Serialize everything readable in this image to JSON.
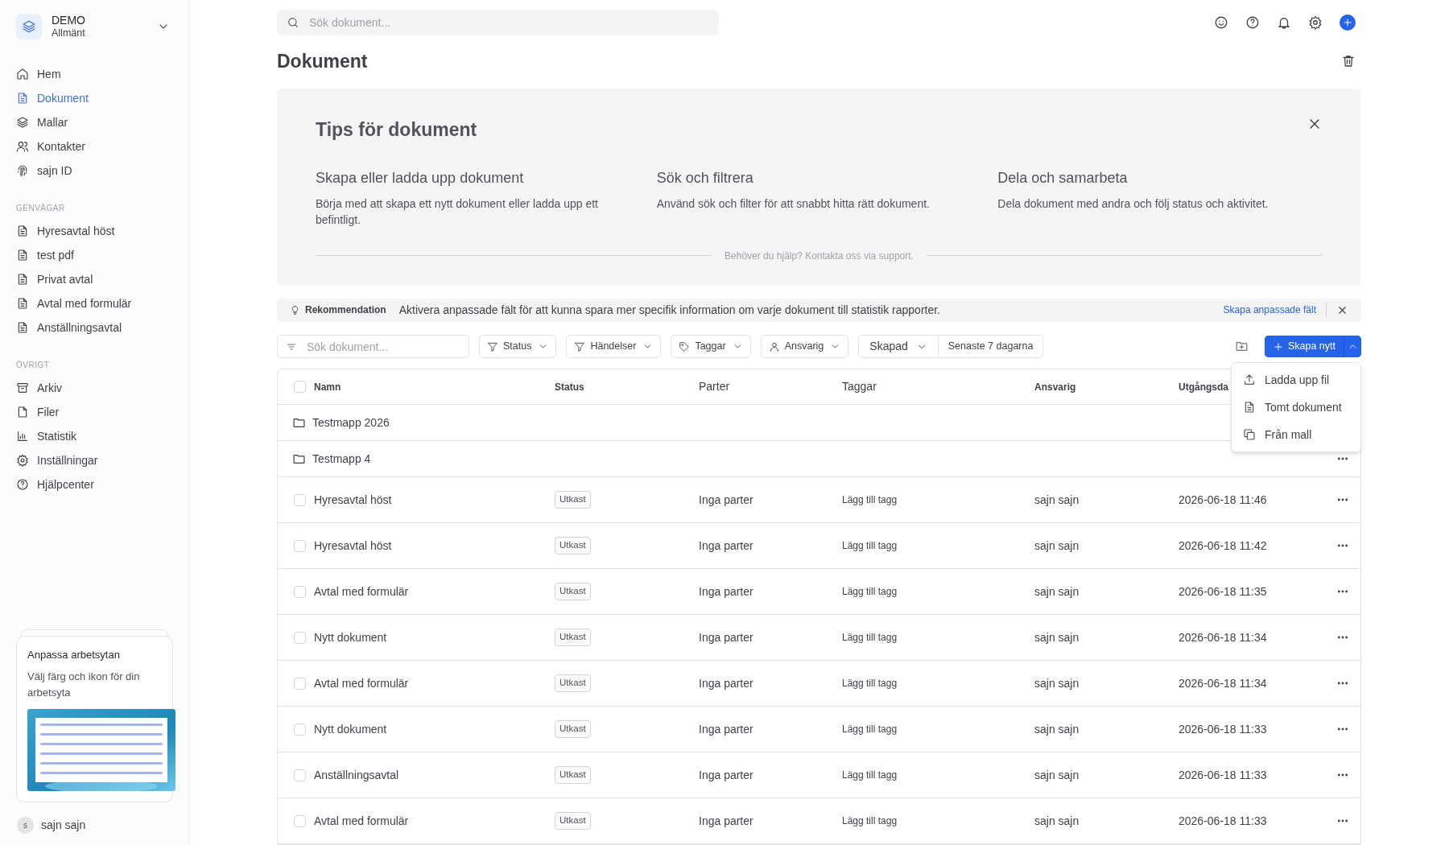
{
  "workspace": {
    "name": "DEMO",
    "subtitle": "Allmänt"
  },
  "nav": [
    {
      "label": "Hem",
      "selected": false
    },
    {
      "label": "Dokument",
      "selected": true
    },
    {
      "label": "Mallar",
      "selected": false
    },
    {
      "label": "Kontakter",
      "selected": false
    },
    {
      "label": "sajn ID",
      "selected": false
    }
  ],
  "sections": [
    {
      "title": "GENVÄGAR",
      "items": [
        "Hyresavtal höst",
        "test pdf",
        "Privat avtal",
        "Avtal med formulär",
        "Anställningsavtal"
      ]
    },
    {
      "title": "ÖVRIGT",
      "items": [
        "Arkiv",
        "Filer",
        "Statistik",
        "Inställningar",
        "Hjälpcenter"
      ]
    }
  ],
  "promo_card": {
    "title": "Anpassa arbetsytan",
    "text": "Välj färg och ikon för din arbetsyta"
  },
  "user": {
    "initial": "s",
    "name": "sajn sajn"
  },
  "search": {
    "placeholder": "Sök dokument..."
  },
  "page_title": "Dokument",
  "tips": {
    "title": "Tips för dokument",
    "columns": [
      {
        "heading": "Skapa eller ladda upp dokument",
        "text": "Börja med att skapa ett nytt dokument eller ladda upp ett befintligt."
      },
      {
        "heading": "Sök och filtrera",
        "text": "Använd sök och filter för att snabbt hitta rätt dokument."
      },
      {
        "heading": "Dela och samarbeta",
        "text": "Dela dokument med andra och följ status och aktivitet."
      }
    ],
    "footer": "Behöver du hjälp? Kontakta oss via support."
  },
  "recommendation": {
    "label": "Rekommendation",
    "text": "Aktivera anpassade fält för att kunna spara mer specifik information om varje dokument till statistik rapporter.",
    "link": "Skapa anpassade fält"
  },
  "filter_search": {
    "placeholder": "Sök dokument..."
  },
  "filters": [
    {
      "label": "Status",
      "kind": "filter"
    },
    {
      "label": "Händelser",
      "kind": "filter"
    },
    {
      "label": "Taggar",
      "kind": "tag"
    },
    {
      "label": "Ansvarig",
      "kind": "person"
    }
  ],
  "date_filter": {
    "field": "Skapad",
    "range": "Senaste 7 dagarna"
  },
  "create_button": {
    "label": "Skapa nytt",
    "expanded": true
  },
  "create_menu": [
    "Ladda upp fil",
    "Tomt dokument",
    "Från mall"
  ],
  "table": {
    "columns": [
      "Namn",
      "Status",
      "Parter",
      "Taggar",
      "Ansvarig",
      "Utgångsda"
    ],
    "select_all": {
      "checked": false
    },
    "folders": [
      {
        "name": "Testmapp 2026",
        "more": false
      },
      {
        "name": "Testmapp 4",
        "more": true
      }
    ],
    "rows": [
      {
        "name": "Hyresavtal höst",
        "status": "Utkast",
        "parties": "Inga parter",
        "tags": "Lägg till tagg",
        "owner": "sajn sajn",
        "date": "2026-06-18 11:46",
        "checked": false
      },
      {
        "name": "Hyresavtal höst",
        "status": "Utkast",
        "parties": "Inga parter",
        "tags": "Lägg till tagg",
        "owner": "sajn sajn",
        "date": "2026-06-18 11:42",
        "checked": false
      },
      {
        "name": "Avtal med formulär",
        "status": "Utkast",
        "parties": "Inga parter",
        "tags": "Lägg till tagg",
        "owner": "sajn sajn",
        "date": "2026-06-18 11:35",
        "checked": false
      },
      {
        "name": "Nytt dokument",
        "status": "Utkast",
        "parties": "Inga parter",
        "tags": "Lägg till tagg",
        "owner": "sajn sajn",
        "date": "2026-06-18 11:34",
        "checked": false
      },
      {
        "name": "Avtal med formulär",
        "status": "Utkast",
        "parties": "Inga parter",
        "tags": "Lägg till tagg",
        "owner": "sajn sajn",
        "date": "2026-06-18 11:34",
        "checked": false
      },
      {
        "name": "Nytt dokument",
        "status": "Utkast",
        "parties": "Inga parter",
        "tags": "Lägg till tagg",
        "owner": "sajn sajn",
        "date": "2026-06-18 11:33",
        "checked": false
      },
      {
        "name": "Anställningsavtal",
        "status": "Utkast",
        "parties": "Inga parter",
        "tags": "Lägg till tagg",
        "owner": "sajn sajn",
        "date": "2026-06-18 11:33",
        "checked": false
      },
      {
        "name": "Avtal med formulär",
        "status": "Utkast",
        "parties": "Inga parter",
        "tags": "Lägg till tagg",
        "owner": "sajn sajn",
        "date": "2026-06-18 11:33",
        "checked": false
      }
    ]
  }
}
